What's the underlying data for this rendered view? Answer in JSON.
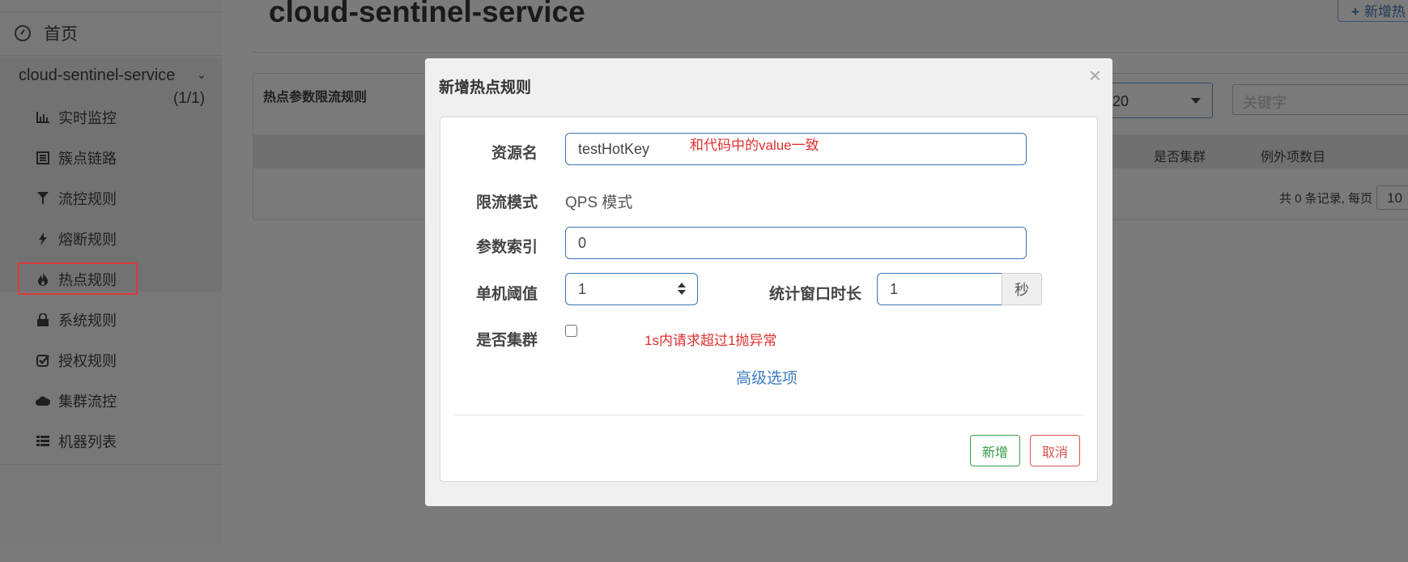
{
  "sidebar": {
    "home_label": "首页",
    "app_name": "cloud-sentinel-service",
    "app_count": "(1/1)",
    "items": [
      {
        "label": "实时监控",
        "icon": "bar-chart-icon"
      },
      {
        "label": "簇点链路",
        "icon": "list-icon"
      },
      {
        "label": "流控规则",
        "icon": "filter-icon"
      },
      {
        "label": "熔断规则",
        "icon": "bolt-icon"
      },
      {
        "label": "热点规则",
        "icon": "fire-icon"
      },
      {
        "label": "系统规则",
        "icon": "lock-icon"
      },
      {
        "label": "授权规则",
        "icon": "check-square-icon"
      },
      {
        "label": "集群流控",
        "icon": "cloud-icon"
      },
      {
        "label": "机器列表",
        "icon": "table-list-icon"
      }
    ]
  },
  "header": {
    "title": "cloud-sentinel-service",
    "add_button": "新增热"
  },
  "panel": {
    "title": "热点参数限流规则",
    "page_size_select": "20",
    "search_placeholder": "关键字",
    "columns": [
      "是否集群",
      "例外项数目"
    ],
    "pagination_text": "共 0 条记录, 每页",
    "pagination_value": "10"
  },
  "modal": {
    "title": "新增热点规则",
    "close_symbol": "×",
    "fields": {
      "resource_label": "资源名",
      "resource_value": "testHotKey",
      "mode_label": "限流模式",
      "mode_value": "QPS 模式",
      "param_index_label": "参数索引",
      "param_index_value": "0",
      "threshold_label": "单机阈值",
      "threshold_value": "1",
      "window_label": "统计窗口时长",
      "window_value": "1",
      "window_unit": "秒",
      "cluster_label": "是否集群"
    },
    "advanced_link": "高级选项",
    "buttons": {
      "add": "新增",
      "cancel": "取消"
    },
    "annotations": {
      "resource_note": "和代码中的value一致",
      "cluster_note": "1s内请求超过1抛异常"
    }
  },
  "colors": {
    "annotation": "#e03030",
    "highlight_box": "#d83b3b",
    "input_border": "#3a76b0",
    "add_button": "#2f9a3f",
    "cancel_button": "#d9534f",
    "link": "#3a7dc0"
  }
}
